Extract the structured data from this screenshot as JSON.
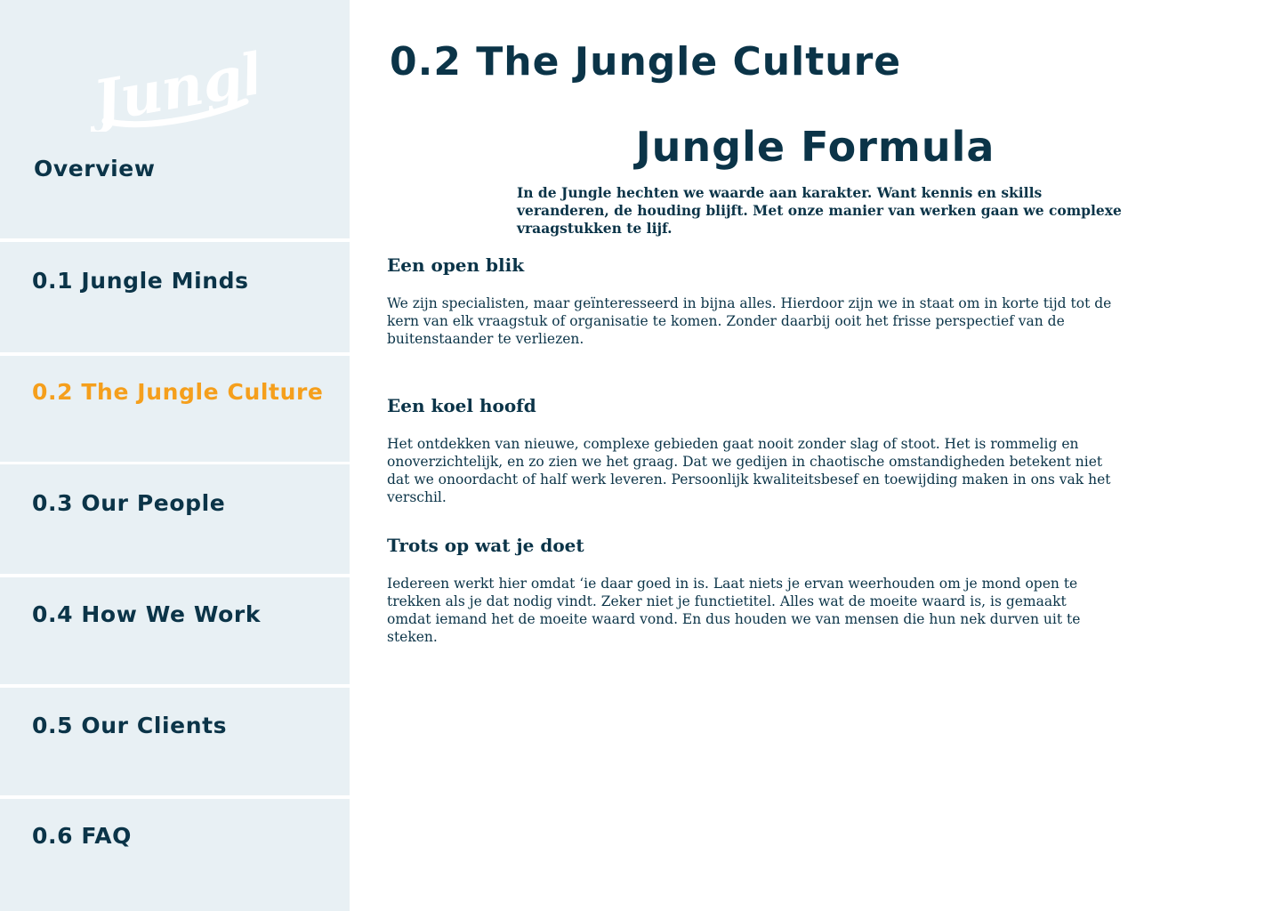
{
  "logo": {
    "text": "Jungle"
  },
  "sidebar": {
    "overview_label": "Overview",
    "items": [
      {
        "label": "0.1 Jungle Minds"
      },
      {
        "label": "0.2 The Jungle Culture"
      },
      {
        "label": "0.3 Our People"
      },
      {
        "label": "0.4 How We Work"
      },
      {
        "label": "0.5 Our Clients"
      },
      {
        "label": "0.6 FAQ"
      }
    ],
    "active_item": "0.2 The Jungle Culture"
  },
  "main": {
    "page_title": "0.2 The Jungle Culture",
    "formula_title": "Jungle Formula",
    "intro": "In de Jungle hechten we waarde aan karakter. Want kennis en skills veranderen, de houding blijft. Met onze manier van werken gaan we complexe vraagstukken te lijf.",
    "sections": [
      {
        "heading": "Een open blik",
        "body": "We zijn specialisten, maar geïnteresseerd in bijna alles. Hierdoor zijn we in staat om in korte tijd tot de kern van elk vraagstuk of organisatie te komen. Zonder daarbij ooit het frisse perspectief van de buitenstaander te verliezen."
      },
      {
        "heading": "Een koel hoofd",
        "body": "Het ontdekken van nieuwe, complexe gebieden gaat nooit zonder slag of stoot. Het is rommelig en onoverzichtelijk, en zo zien we het graag. Dat we gedijen in chaotische omstandigheden betekent niet dat we onoordacht of half werk leveren. Persoonlijk kwaliteitsbesef en toewijding maken in ons vak het verschil."
      },
      {
        "heading": "Trots op wat je doet",
        "body": "Iedereen werkt hier omdat ‘ie daar goed in is. Laat niets je ervan weerhouden om je mond open te trekken als je dat nodig vindt. Zeker niet je functietitel. Alles wat de moeite waard is, is gemaakt omdat iemand het de moeite waard vond. En dus houden we van mensen die hun nek durven uit te steken."
      }
    ]
  },
  "colors": {
    "sidebar_bg": "#e8f0f4",
    "text_dark": "#0b3448",
    "accent_orange": "#f59f1c",
    "logo": "#ffffff"
  },
  "icons": {
    "logo": "jungle-logo"
  }
}
